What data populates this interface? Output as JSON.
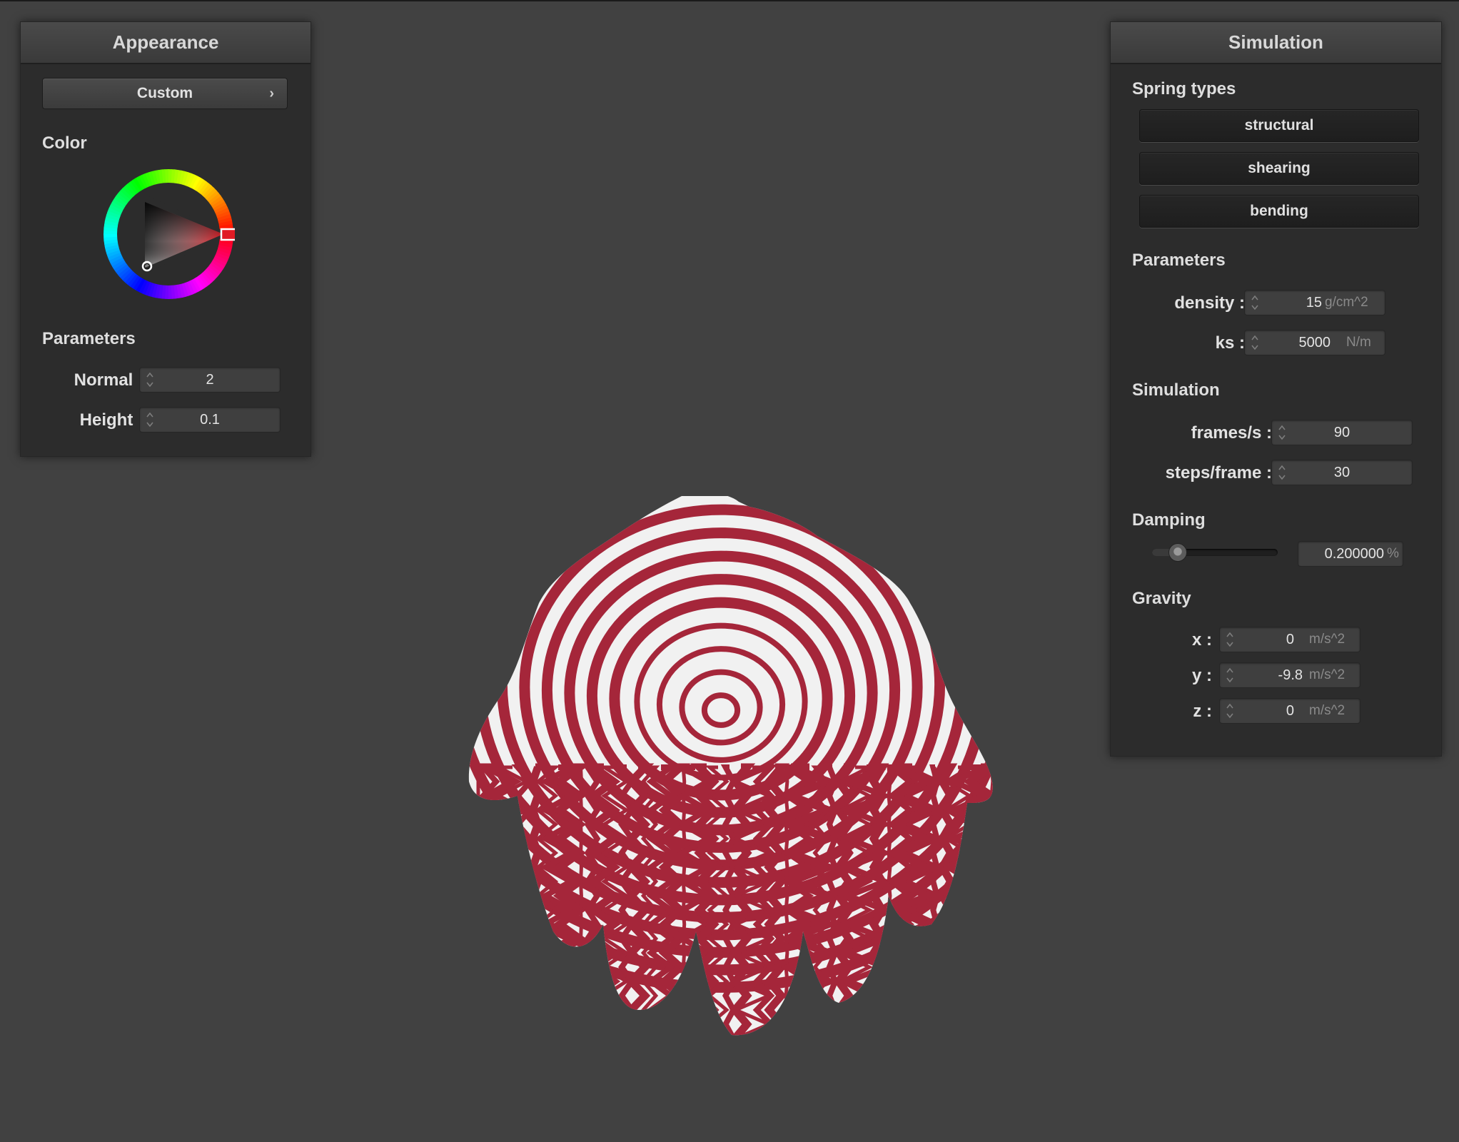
{
  "appearance": {
    "title": "Appearance",
    "material_dropdown": "Custom",
    "chevron": "›",
    "color_label": "Color",
    "selected_color": "#e01b24",
    "parameters_label": "Parameters",
    "normal": {
      "label": "Normal :",
      "value": "2"
    },
    "height": {
      "label": "Height :",
      "value": "0.1"
    }
  },
  "simulation": {
    "title": "Simulation",
    "spring_types_label": "Spring types",
    "spring_buttons": [
      "structural",
      "shearing",
      "bending"
    ],
    "parameters_label": "Parameters",
    "density": {
      "label": "density :",
      "value": "15",
      "unit": "g/cm^2"
    },
    "ks": {
      "label": "ks :",
      "value": "5000",
      "unit": "N/m"
    },
    "simulation_label": "Simulation",
    "fps": {
      "label": "frames/s :",
      "value": "90"
    },
    "steps": {
      "label": "steps/frame :",
      "value": "30"
    },
    "damping_label": "Damping",
    "damping": {
      "value": "0.200000",
      "unit": "%",
      "slider_fraction": 0.2
    },
    "gravity_label": "Gravity",
    "gravity_x": {
      "label": "x :",
      "value": "0",
      "unit": "m/s^2"
    },
    "gravity_y": {
      "label": "y :",
      "value": "-9.8",
      "unit": "m/s^2"
    },
    "gravity_z": {
      "label": "z :",
      "value": "0",
      "unit": "m/s^2"
    }
  },
  "viewport": {
    "cloth_colors": [
      "#a5263a",
      "#f2f2f2"
    ]
  }
}
